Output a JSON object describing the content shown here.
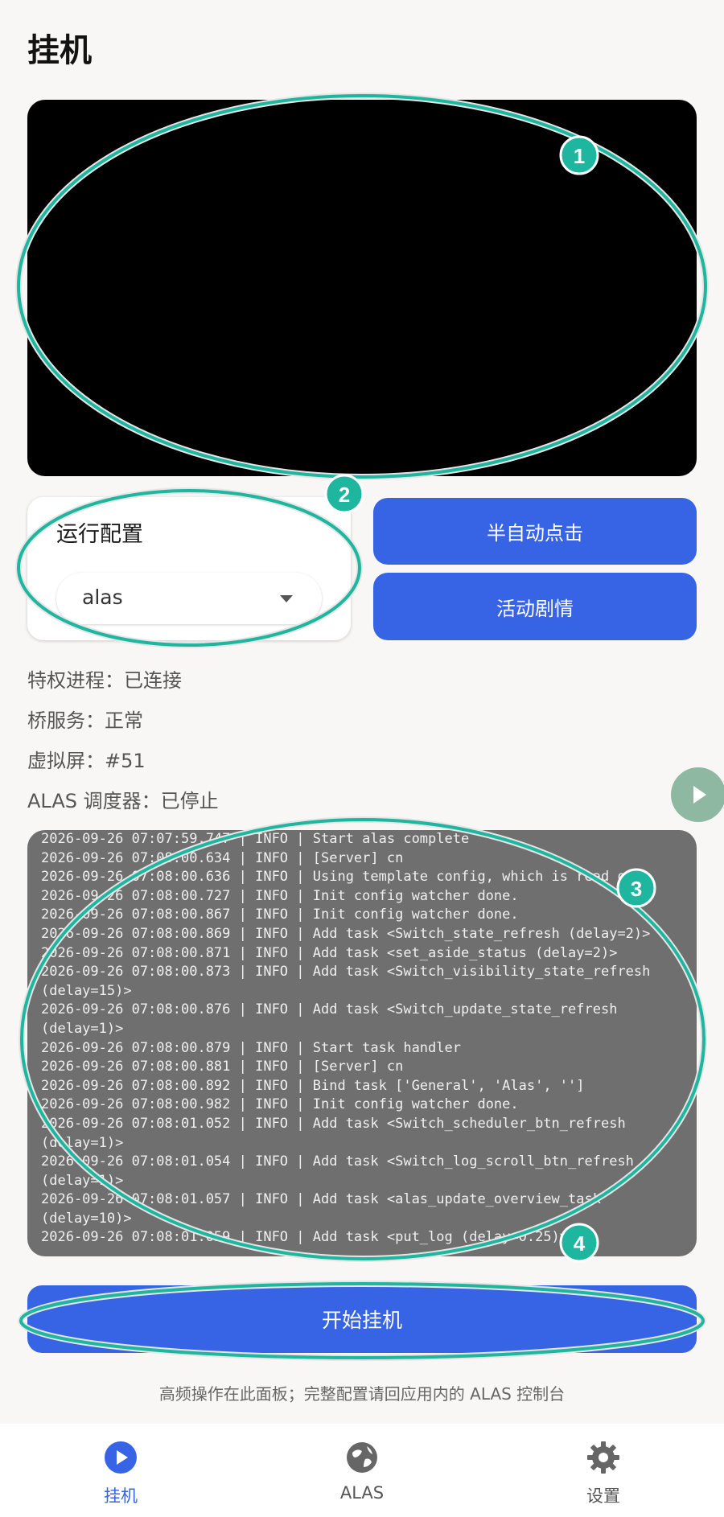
{
  "page": {
    "title": "挂机"
  },
  "config": {
    "label": "运行配置",
    "selected": "alas"
  },
  "actions": {
    "semi_auto_click": "半自动点击",
    "event_story": "活动剧情"
  },
  "status": {
    "privileged_process": "特权进程：已连接",
    "bridge_service": "桥服务：正常",
    "virtual_display": "虚拟屏：#51",
    "alas_scheduler": "ALAS 调度器：已停止"
  },
  "log": {
    "lines": [
      "2026-09-26 07:07:59.747 | INFO | Start alas complete",
      "2026-09-26 07:08:00.634 | INFO | [Server] cn",
      "2026-09-26 07:08:00.636 | INFO | Using template config, which is read only",
      "2026-09-26 07:08:00.727 | INFO | Init config watcher done.",
      "2026-09-26 07:08:00.867 | INFO | Init config watcher done.",
      "2026-09-26 07:08:00.869 | INFO | Add task <Switch_state_refresh (delay=2)>",
      "2026-09-26 07:08:00.871 | INFO | Add task <set_aside_status (delay=2)>",
      "2026-09-26 07:08:00.873 | INFO | Add task <Switch_visibility_state_refresh",
      "(delay=15)>",
      "2026-09-26 07:08:00.876 | INFO | Add task <Switch_update_state_refresh",
      "(delay=1)>",
      "2026-09-26 07:08:00.879 | INFO | Start task handler",
      "2026-09-26 07:08:00.881 | INFO | [Server] cn",
      "2026-09-26 07:08:00.892 | INFO | Bind task ['General', 'Alas', '']",
      "2026-09-26 07:08:00.982 | INFO | Init config watcher done.",
      "2026-09-26 07:08:01.052 | INFO | Add task <Switch_scheduler_btn_refresh",
      "(delay=1)>",
      "2026-09-26 07:08:01.054 | INFO | Add task <Switch_log_scroll_btn_refresh",
      "(delay=1)>",
      "2026-09-26 07:08:01.057 | INFO | Add task <alas_update_overview_task",
      "(delay=10)>",
      "2026-09-26 07:08:01.059 | INFO | Add task <put_log (delay=0.25)>"
    ]
  },
  "start_button": "开始挂机",
  "footer_note": "高频操作在此面板；完整配置请回应用内的 ALAS 控制台",
  "nav": {
    "items": [
      {
        "label": "挂机",
        "icon": "play-circle-icon"
      },
      {
        "label": "ALAS",
        "icon": "globe-icon"
      },
      {
        "label": "设置",
        "icon": "gear-icon"
      }
    ]
  },
  "annotations": {
    "markers": [
      "1",
      "2",
      "3",
      "4"
    ]
  },
  "colors": {
    "accent": "#3764e5",
    "annotation": "#1fb6a0",
    "log_bg": "#6f6f6f"
  }
}
